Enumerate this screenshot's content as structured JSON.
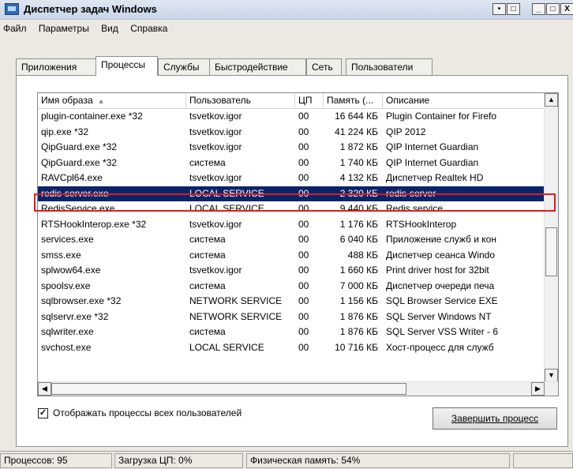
{
  "window": {
    "title": "Диспетчер задач Windows"
  },
  "titlebar_buttons": [
    "•",
    "□",
    "_",
    "□",
    "X"
  ],
  "menu": [
    "Файл",
    "Параметры",
    "Вид",
    "Справка"
  ],
  "tabs": [
    "Приложения",
    "Процессы",
    "Службы",
    "Быстродействие",
    "Сеть",
    "Пользователи"
  ],
  "active_tab": "Процессы",
  "columns": [
    "Имя образа",
    "Пользователь",
    "ЦП",
    "Память (...",
    "Описание"
  ],
  "rows": [
    {
      "name": "plugin-container.exe *32",
      "user": "tsvetkov.igor",
      "cpu": "00",
      "mem": "16 644 КБ",
      "desc": "Plugin Container for Firefo"
    },
    {
      "name": "qip.exe *32",
      "user": "tsvetkov.igor",
      "cpu": "00",
      "mem": "41 224 КБ",
      "desc": "QIP 2012"
    },
    {
      "name": "QipGuard.exe *32",
      "user": "tsvetkov.igor",
      "cpu": "00",
      "mem": "1 872 КБ",
      "desc": "QIP Internet Guardian"
    },
    {
      "name": "QipGuard.exe *32",
      "user": "система",
      "cpu": "00",
      "mem": "1 740 КБ",
      "desc": "QIP Internet Guardian"
    },
    {
      "name": "RAVCpl64.exe",
      "user": "tsvetkov.igor",
      "cpu": "00",
      "mem": "4 132 КБ",
      "desc": "Диспетчер Realtek HD"
    },
    {
      "name": "redis-server.exe",
      "user": "LOCAL SERVICE",
      "cpu": "00",
      "mem": "2 320 КБ",
      "desc": "redis-server",
      "selected": true
    },
    {
      "name": "RedisService.exe",
      "user": "LOCAL SERVICE",
      "cpu": "00",
      "mem": "9 440 КБ",
      "desc": "Redis service"
    },
    {
      "name": "RTSHookInterop.exe *32",
      "user": "tsvetkov.igor",
      "cpu": "00",
      "mem": "1 176 КБ",
      "desc": "RTSHookInterop"
    },
    {
      "name": "services.exe",
      "user": "система",
      "cpu": "00",
      "mem": "6 040 КБ",
      "desc": "Приложение служб и кон"
    },
    {
      "name": "smss.exe",
      "user": "система",
      "cpu": "00",
      "mem": "488 КБ",
      "desc": "Диспетчер сеанса Windo"
    },
    {
      "name": "splwow64.exe",
      "user": "tsvetkov.igor",
      "cpu": "00",
      "mem": "1 660 КБ",
      "desc": "Print driver host for 32bit"
    },
    {
      "name": "spoolsv.exe",
      "user": "система",
      "cpu": "00",
      "mem": "7 000 КБ",
      "desc": "Диспетчер очереди печа"
    },
    {
      "name": "sqlbrowser.exe *32",
      "user": "NETWORK SERVICE",
      "cpu": "00",
      "mem": "1 156 КБ",
      "desc": "SQL Browser Service EXE"
    },
    {
      "name": "sqlservr.exe *32",
      "user": "NETWORK SERVICE",
      "cpu": "00",
      "mem": "1 876 КБ",
      "desc": "SQL Server Windows NT"
    },
    {
      "name": "sqlwriter.exe",
      "user": "система",
      "cpu": "00",
      "mem": "1 876 КБ",
      "desc": "SQL Server VSS Writer - 6"
    },
    {
      "name": "svchost.exe",
      "user": "LOCAL SERVICE",
      "cpu": "00",
      "mem": "10 716 КБ",
      "desc": "Хост-процесс для служб"
    }
  ],
  "show_all_label": "Отображать процессы всех пользователей",
  "show_all_checked": "✓",
  "end_process_label": "Завершить процесс",
  "status": {
    "processes": "Процессов: 95",
    "cpu": "Загрузка ЦП: 0%",
    "memory": "Физическая память: 54%"
  },
  "colors": {
    "selection": "#0a246a",
    "highlight_box": "#e21b1b"
  }
}
